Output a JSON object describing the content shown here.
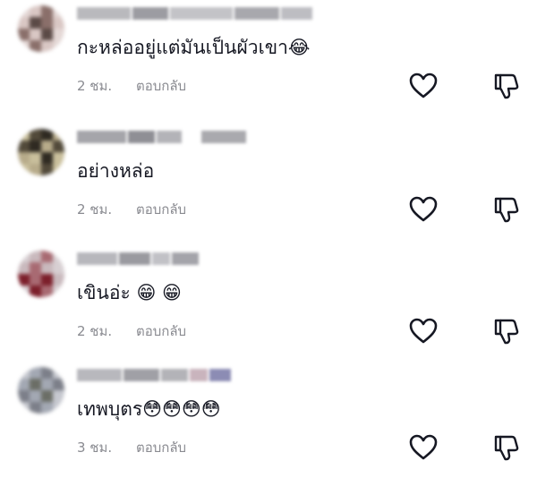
{
  "comments": [
    {
      "text": "กะหล่ออยู่แต่มันเป็นผัวเขา",
      "emoji": "😂",
      "time": "2 ชม.",
      "reply_label": "ตอบกลับ",
      "avatar_colors": [
        "#d9c7c4",
        "#8a6f6a",
        "#5b4a46",
        "#e4d8d6"
      ]
    },
    {
      "text": "อย่างหล่อ",
      "emoji": "",
      "time": "2 ชม.",
      "reply_label": "ตอบกลับ",
      "avatar_colors": [
        "#b7ab8a",
        "#524a3a",
        "#2f2a22",
        "#c9bf9c"
      ]
    },
    {
      "text": "เขินอ่ะ",
      "emoji": "😁 😁",
      "time": "2 ชม.",
      "reply_label": "ตอบกลับ",
      "avatar_colors": [
        "#c9b9bd",
        "#a86a72",
        "#7c1f2b",
        "#d7cfd2"
      ]
    },
    {
      "text": "เทพบุตร",
      "emoji": "😳😳😳😳",
      "time": "3 ชม.",
      "reply_label": "ตอบกลับ",
      "avatar_colors": [
        "#a3a8b3",
        "#6b6e66",
        "#c6c8cf",
        "#7c7f89"
      ]
    }
  ],
  "icons": {
    "like": "heart-outline-icon",
    "dislike": "thumbs-down-outline-icon"
  },
  "colors": {
    "text": "#161823",
    "meta": "#8a8b91",
    "icon_stroke": "#161823"
  }
}
